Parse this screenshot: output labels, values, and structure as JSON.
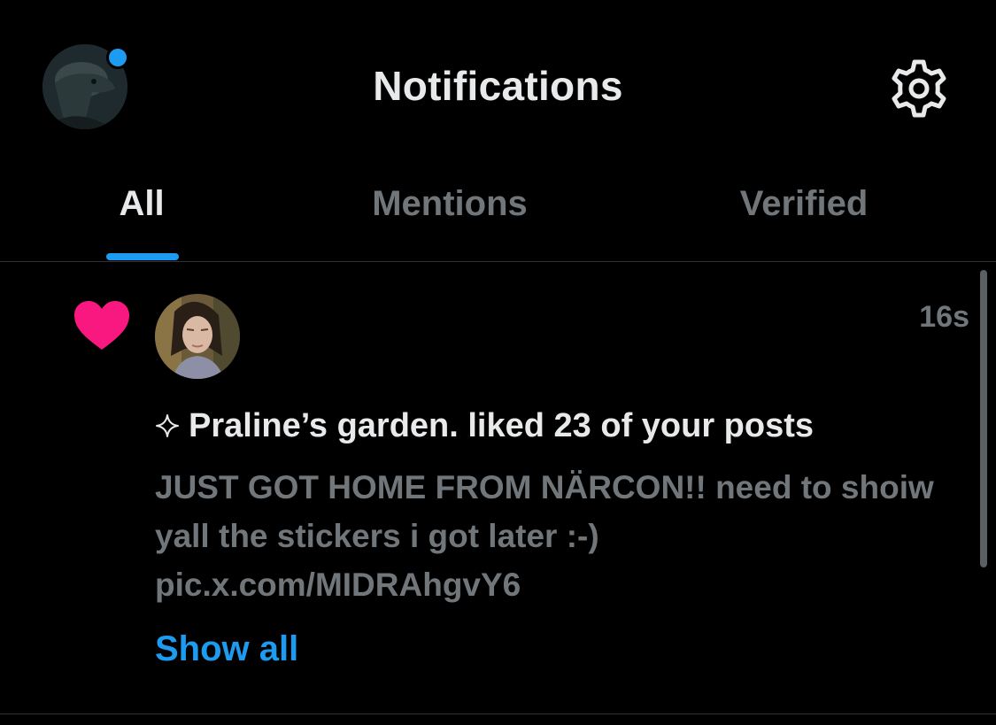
{
  "header": {
    "title": "Notifications",
    "avatar_icon": "user-avatar-icon",
    "settings_icon": "gear-icon",
    "unread_dot_color": "#1d9bf0"
  },
  "tabs": [
    {
      "label": "All",
      "active": true
    },
    {
      "label": "Mentions",
      "active": false
    },
    {
      "label": "Verified",
      "active": false
    }
  ],
  "notification": {
    "type_icon": "heart-icon",
    "type_icon_color": "#f91880",
    "timestamp": "16s",
    "headline_icon": "sparkle-icon",
    "headline": "Praline’s garden. liked 23 of your posts",
    "post_text": "JUST GOT HOME FROM NÄRCON!! need to shoiw yall the stickers i got later :-) pic.x.com/MIDRAhgvY6",
    "show_all_label": "Show all"
  },
  "colors": {
    "background": "#000000",
    "primary_text": "#e7e9ea",
    "secondary_text": "#71767b",
    "accent": "#1d9bf0",
    "like": "#f91880"
  }
}
